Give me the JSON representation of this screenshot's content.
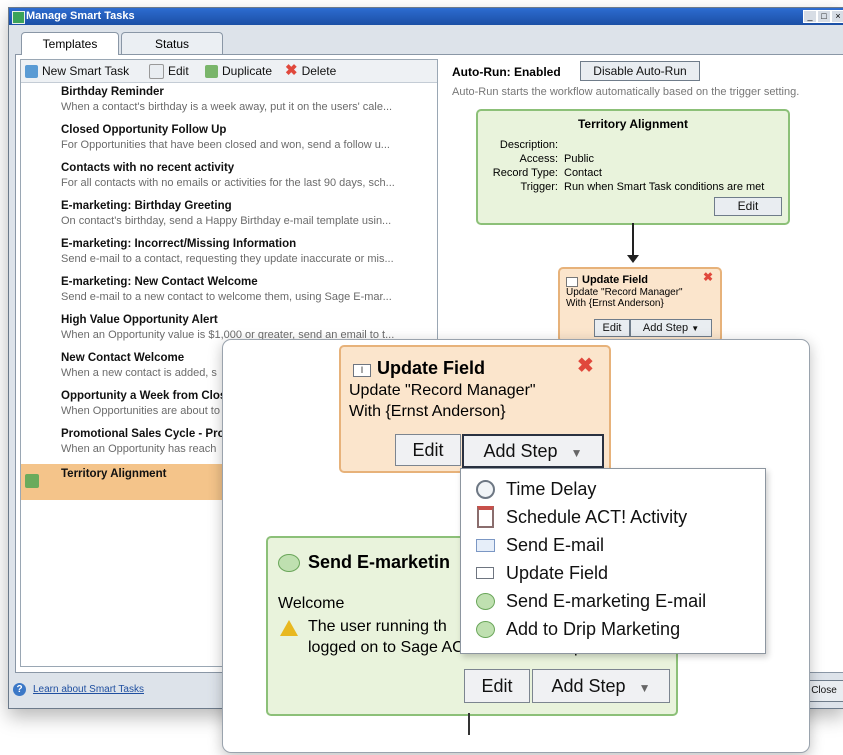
{
  "window": {
    "title": "Manage Smart Tasks",
    "controls": [
      "_",
      "□",
      "×"
    ]
  },
  "tabs": [
    {
      "label": "Templates",
      "active": true
    },
    {
      "label": "Status",
      "active": false
    }
  ],
  "left_toolbar": {
    "new_label": "New Smart Task",
    "edit_label": "Edit",
    "duplicate_label": "Duplicate",
    "delete_label": "Delete"
  },
  "templates": [
    {
      "title": "Birthday Reminder",
      "desc": "When a contact's birthday is a week away, put it on the users' cale..."
    },
    {
      "title": "Closed Opportunity Follow Up",
      "desc": "For Opportunities that have been closed and won, send a follow u..."
    },
    {
      "title": "Contacts with no recent activity",
      "desc": "For all contacts with no emails or activities for the last 90 days, sch..."
    },
    {
      "title": "E-marketing: Birthday Greeting",
      "desc": "On contact's birthday, send a Happy Birthday e-mail template usin..."
    },
    {
      "title": "E-marketing: Incorrect/Missing Information",
      "desc": "Send e-mail to a contact, requesting they update inaccurate or mis..."
    },
    {
      "title": "E-marketing: New Contact Welcome",
      "desc": "Send e-mail to a new contact to welcome them, using Sage E-mar..."
    },
    {
      "title": "High Value Opportunity Alert",
      "desc": "When an Opportunity value is $1,000 or greater, send an email to t..."
    },
    {
      "title": "New Contact Welcome",
      "desc": "When a new contact is added, s"
    },
    {
      "title": "Opportunity a Week from Clos",
      "desc": "When Opportunities are about to"
    },
    {
      "title": "Promotional Sales Cycle - Pro",
      "desc": "When an Opportunity has reach"
    },
    {
      "title": "Territory Alignment",
      "desc": "",
      "selected": true
    }
  ],
  "autorun": {
    "label": "Auto-Run: Enabled",
    "button": "Disable Auto-Run",
    "note": "Auto-Run starts the workflow automatically based on the trigger setting."
  },
  "trigger_node": {
    "title": "Territory Alignment",
    "description_label": "Description:",
    "description": "",
    "access_label": "Access:",
    "access": "Public",
    "record_type_label": "Record Type:",
    "record_type": "Contact",
    "trigger_label": "Trigger:",
    "trigger": "Run when Smart Task conditions are met",
    "edit": "Edit"
  },
  "small_step": {
    "title": "Update Field",
    "line1": "Update \"Record Manager\"",
    "line2": "With {Ernst Anderson}",
    "edit": "Edit",
    "add_step": "Add Step"
  },
  "bottom": {
    "help_link": "Learn about Smart Tasks",
    "close": "Close"
  },
  "zoom": {
    "update_step": {
      "title": "Update Field",
      "line1": "Update \"Record Manager\"",
      "line2": "With {Ernst Anderson}",
      "edit": "Edit",
      "add_step": "Add Step"
    },
    "menu": [
      {
        "label": "Time Delay",
        "icon": "stopwatch-icon"
      },
      {
        "label": "Schedule ACT! Activity",
        "icon": "calendar-icon"
      },
      {
        "label": "Send E-mail",
        "icon": "envelope-icon"
      },
      {
        "label": "Update Field",
        "icon": "text-field-icon"
      },
      {
        "label": "Send E-marketing E-mail",
        "icon": "emarketing-icon"
      },
      {
        "label": "Add to Drip Marketing",
        "icon": "drip-marketing-icon"
      }
    ],
    "emarketing_step": {
      "title": "Send E-marketin",
      "welcome": "Welcome",
      "warning_line1": "The user running th",
      "warning_line2": "logged on to Sage ACT! while this step runs.",
      "edit": "Edit",
      "add_step": "Add Step"
    }
  },
  "colors": {
    "selection": "#f4c48a",
    "node_green_border": "#8cc078",
    "node_orange_border": "#e7b27a",
    "delete_red": "#e0483c",
    "title_bar": "#1b4fa5"
  }
}
